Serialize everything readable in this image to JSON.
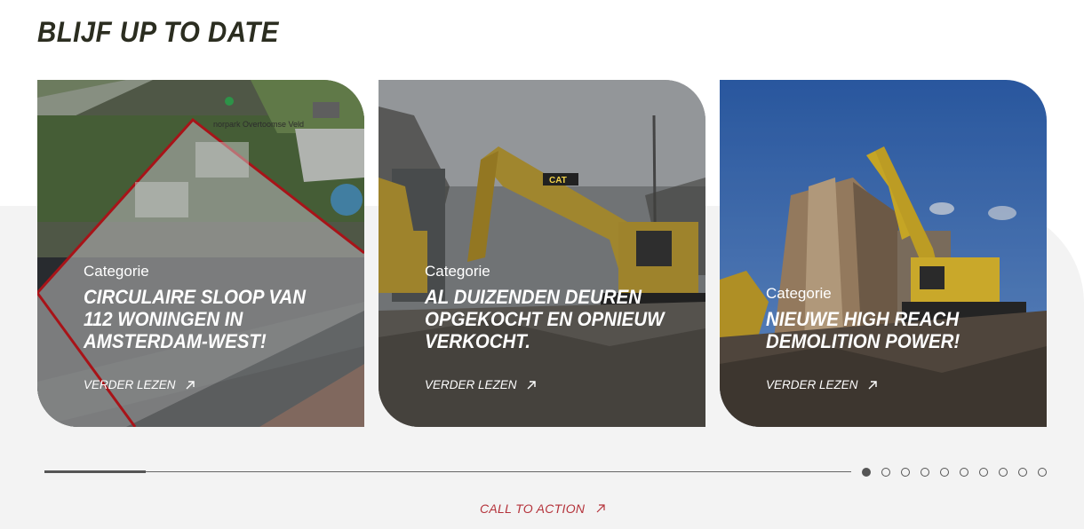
{
  "section": {
    "title": "BLIJF UP TO DATE"
  },
  "cards": [
    {
      "category": "Categorie",
      "title": "CIRCULAIRE SLOOP VAN 112 WONINGEN IN AMSTERDAM-WEST!",
      "link_label": "VERDER LEZEN",
      "image": "aerial-map-photo",
      "map_label": "norpark Overtoomse Veld"
    },
    {
      "category": "Categorie",
      "title": "AL DUIZENDEN DEUREN OPGEKOCHT EN OPNIEUW VERKOCHT.",
      "link_label": "VERDER LEZEN",
      "image": "excavator-demolition-photo",
      "brand_mark": "CAT"
    },
    {
      "category": "Categorie",
      "title": "NIEUWE HIGH REACH DEMOLITION POWER!",
      "link_label": "VERDER LEZEN",
      "image": "high-reach-demolition-photo"
    }
  ],
  "carousel": {
    "total_slides": 10,
    "active_index": 0,
    "progress_fraction": 0.126
  },
  "cta": {
    "label": "CALL TO ACTION"
  },
  "colors": {
    "title": "#2b2d20",
    "cta": "#b4323a",
    "band": "#f3f3f3"
  }
}
